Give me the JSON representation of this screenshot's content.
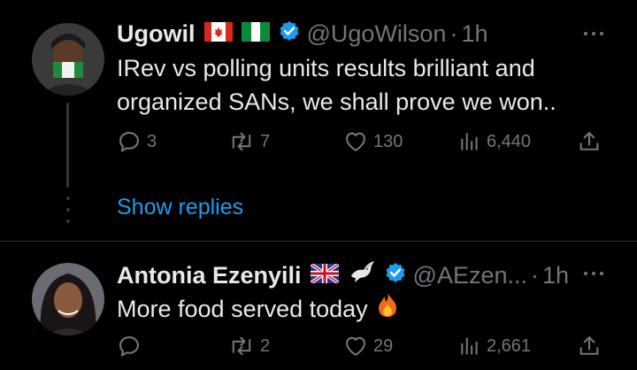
{
  "tweets": [
    {
      "name": "Ugowil",
      "flags": [
        "canada-flag-icon",
        "nigeria-flag-icon"
      ],
      "verified": true,
      "handle": "@UgoWilson",
      "separator": "·",
      "time": "1h",
      "text_lines": [
        "IRev vs polling units results brilliant and",
        "organized SANs, we shall prove we won.."
      ],
      "actions": {
        "replies": "3",
        "reposts": "7",
        "likes": "130",
        "views": "6,440"
      },
      "show_replies": "Show replies"
    },
    {
      "name": "Antonia Ezenyili",
      "flags": [
        "uk-flag-icon",
        "dove-icon"
      ],
      "verified": true,
      "handle": "@AEzen...",
      "separator": "·",
      "time": "1h",
      "text": "More food served today",
      "emoji": "fire-icon",
      "actions": {
        "replies": "",
        "reposts": "2",
        "likes": "29",
        "views": "2,661"
      }
    }
  ],
  "colors": {
    "background": "#000000",
    "text": "#e7e9ea",
    "muted": "#71767b",
    "accent": "#1d9bf0",
    "divider": "#2f3336"
  }
}
